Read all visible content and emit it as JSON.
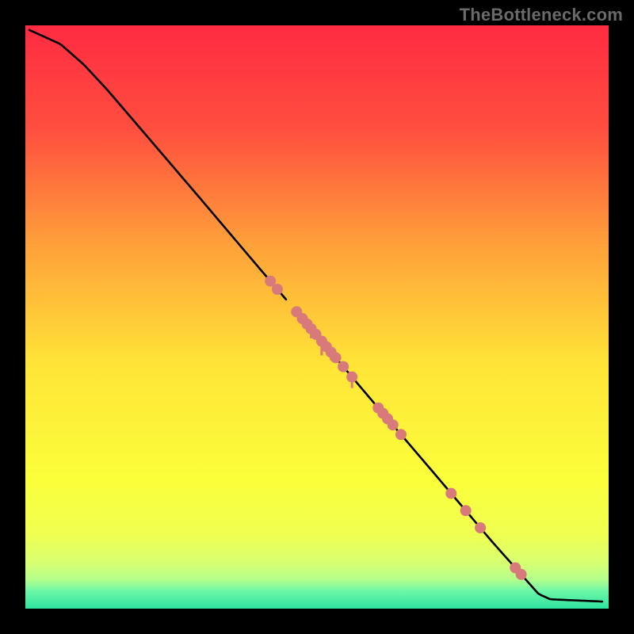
{
  "watermark": "TheBottleneck.com",
  "gradient": {
    "stops": [
      {
        "pct": 0,
        "color": "#ff2b42"
      },
      {
        "pct": 18,
        "color": "#ff4f3f"
      },
      {
        "pct": 38,
        "color": "#ffa23a"
      },
      {
        "pct": 58,
        "color": "#ffe437"
      },
      {
        "pct": 78,
        "color": "#fbff3a"
      },
      {
        "pct": 87,
        "color": "#f0ff50"
      },
      {
        "pct": 92,
        "color": "#d9ff70"
      },
      {
        "pct": 95,
        "color": "#b5ff8c"
      },
      {
        "pct": 97,
        "color": "#6cf7a8"
      },
      {
        "pct": 100,
        "color": "#2de3a0"
      }
    ]
  },
  "chart_data": {
    "type": "line",
    "title": "",
    "xlabel": "",
    "ylabel": "",
    "xlim": [
      0,
      100
    ],
    "ylim": [
      0,
      100
    ],
    "curve": [
      {
        "x": 0.7,
        "y": 99.2
      },
      {
        "x": 6.0,
        "y": 96.8
      },
      {
        "x": 10.0,
        "y": 93.3
      },
      {
        "x": 14.0,
        "y": 89.0
      },
      {
        "x": 20.0,
        "y": 82.0
      },
      {
        "x": 30.0,
        "y": 70.3
      },
      {
        "x": 40.0,
        "y": 58.5
      },
      {
        "x": 50.0,
        "y": 46.8
      },
      {
        "x": 60.0,
        "y": 35.0
      },
      {
        "x": 70.0,
        "y": 23.3
      },
      {
        "x": 80.0,
        "y": 11.5
      },
      {
        "x": 88.0,
        "y": 2.5
      },
      {
        "x": 90.0,
        "y": 1.6
      },
      {
        "x": 99.3,
        "y": 1.2
      }
    ],
    "notch_x": 46.0,
    "markers": {
      "color": "#d97a7a",
      "radius": 7,
      "points_x": [
        42.0,
        43.2,
        46.5,
        47.5,
        48.3,
        49.0,
        49.8,
        50.8,
        51.6,
        52.4,
        53.2,
        54.5,
        56.0,
        60.5,
        61.3,
        62.1,
        63.0,
        64.4,
        73.0,
        75.5,
        78.0,
        84.0,
        85.0
      ]
    },
    "drip_bars": {
      "color": "#d97a7a",
      "width": 3,
      "bars": [
        {
          "x": 49.0,
          "len": 12
        },
        {
          "x": 50.8,
          "len": 18
        },
        {
          "x": 52.4,
          "len": 10
        },
        {
          "x": 56.0,
          "len": 14
        }
      ]
    }
  }
}
